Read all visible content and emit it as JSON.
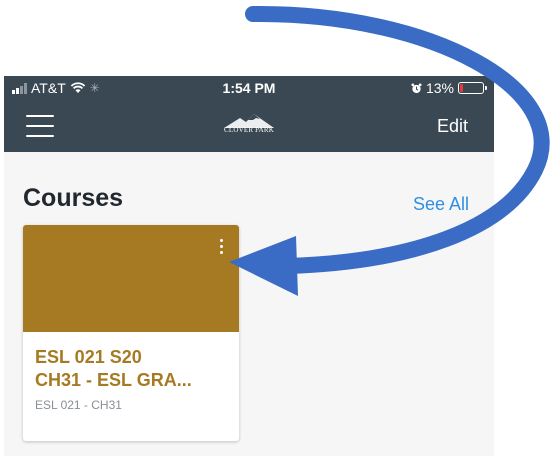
{
  "status_bar": {
    "carrier": "AT&T",
    "time": "1:54 PM",
    "battery": "13%",
    "battery_level": 0.13
  },
  "nav": {
    "logo_text": "CLOVER PARK",
    "edit_label": "Edit"
  },
  "section": {
    "title": "Courses",
    "see_all_label": "See All"
  },
  "course": {
    "name": "ESL  021  S20\nCH31 - ESL GRA...",
    "code": "ESL  021 - CH31",
    "color": "#a67a22"
  },
  "colors": {
    "nav_bg": "#3a4853",
    "link": "#2f8fe0",
    "arrow": "#3a6cc6"
  }
}
